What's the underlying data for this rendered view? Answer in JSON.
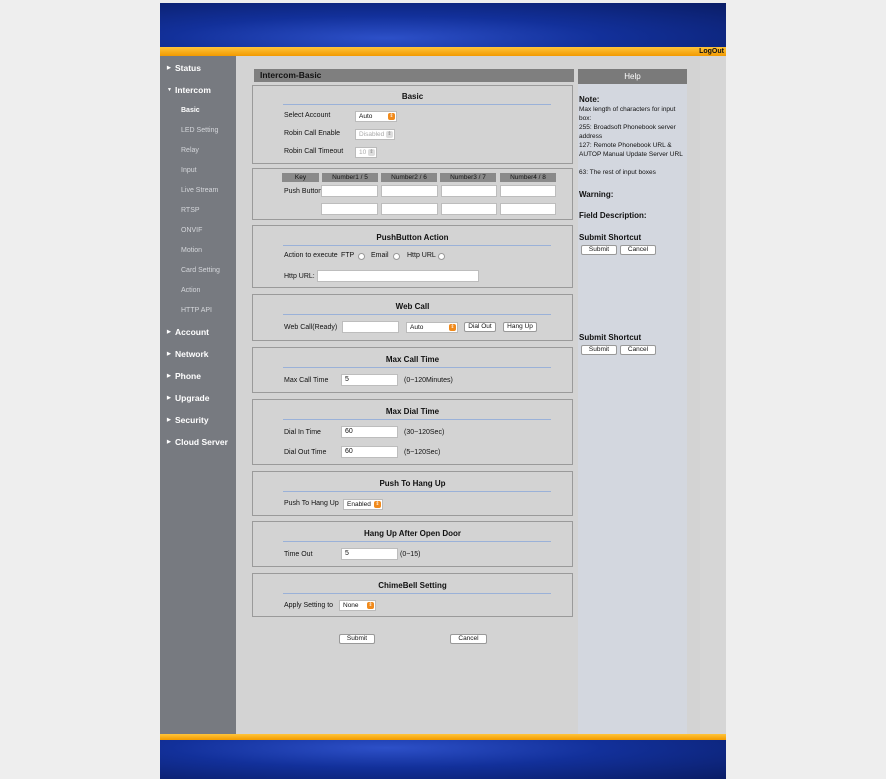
{
  "header": {
    "logout": "LogOut"
  },
  "sidebar": {
    "status": "Status",
    "intercom": "Intercom",
    "sub": [
      "Basic",
      "LED Setting",
      "Relay",
      "Input",
      "Live Stream",
      "RTSP",
      "ONVIF",
      "Motion",
      "Card Setting",
      "Action",
      "HTTP API"
    ],
    "account": "Account",
    "network": "Network",
    "phone": "Phone",
    "upgrade": "Upgrade",
    "security": "Security",
    "cloud": "Cloud Server"
  },
  "page": {
    "title": "Intercom-Basic"
  },
  "basic": {
    "title": "Basic",
    "select_account_label": "Select Account",
    "select_account_value": "Auto",
    "robin_enable_label": "Robin Call Enable",
    "robin_enable_value": "Disabled",
    "robin_timeout_label": "Robin Call Timeout",
    "robin_timeout_value": "10",
    "key_header": "Key",
    "number_headers": [
      "Number1 / 5",
      "Number2 / 6",
      "Number3 / 7",
      "Number4 / 8"
    ],
    "push_button_label": "Push Button"
  },
  "push_action": {
    "title": "PushButton Action",
    "action_label": "Action to execute",
    "ftp": "FTP",
    "email": "Email",
    "http_url": "Http URL",
    "http_url_label": "Http URL:"
  },
  "web_call": {
    "title": "Web Call",
    "label": "Web Call(Ready)",
    "select_value": "Auto",
    "dial_out": "Dial Out",
    "hang_up": "Hang Up"
  },
  "max_call": {
    "title": "Max Call Time",
    "label": "Max Call Time",
    "value": "5",
    "hint": "(0~120Minutes)"
  },
  "max_dial": {
    "title": "Max Dial Time",
    "dial_in_label": "Dial In Time",
    "dial_in_value": "60",
    "dial_in_hint": "(30~120Sec)",
    "dial_out_label": "Dial Out Time",
    "dial_out_value": "60",
    "dial_out_hint": "(5~120Sec)"
  },
  "push_hang": {
    "title": "Push To Hang Up",
    "label": "Push To Hang Up",
    "value": "Enabled"
  },
  "hang_after": {
    "title": "Hang Up After Open Door",
    "label": "Time Out",
    "value": "5",
    "hint": "(0~15)"
  },
  "chime": {
    "title": "ChimeBell Setting",
    "label": "Apply Setting to",
    "value": "None"
  },
  "actions": {
    "submit": "Submit",
    "cancel": "Cancel"
  },
  "help": {
    "title": "Help",
    "note": "Note:",
    "note_lines": [
      "Max length of characters for input box:",
      "255: Broadsoft Phonebook server address",
      "127: Remote Phonebook URL & AUTOP Manual Update Server URL",
      "63: The rest of input boxes"
    ],
    "warning": "Warning:",
    "field_desc": "Field Description:",
    "shortcut": "Submit Shortcut",
    "submit": "Submit",
    "cancel": "Cancel"
  },
  "colors": {
    "accent_orange": "#f29a00",
    "banner_blue": "#12309a",
    "sidebar_gray": "#777a80"
  }
}
